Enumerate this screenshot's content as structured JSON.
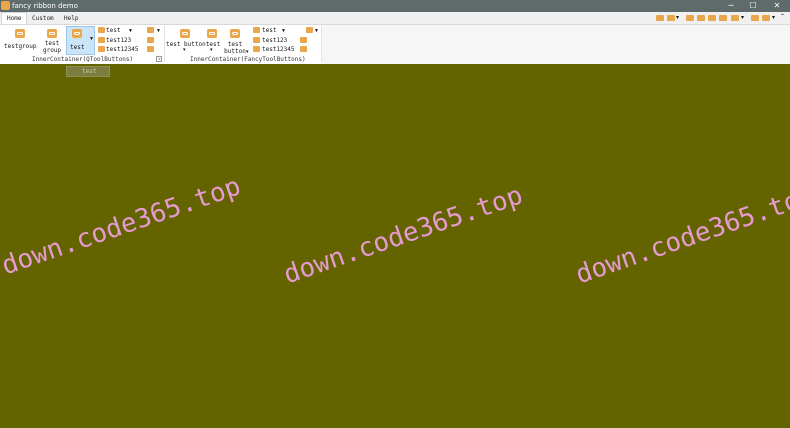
{
  "window": {
    "title": "fancy ribbon demo",
    "minimize": "─",
    "maximize": "☐",
    "close": "✕"
  },
  "tabs": [
    "Home",
    "Custom",
    "Help"
  ],
  "group1": {
    "testgroup": "testgroup",
    "test_group_line1": "test",
    "test_group_line2": "group",
    "test_dropdown": "test",
    "list": [
      "test",
      "test123",
      "test12345"
    ],
    "title": "InnerContainer(QToolButtons)"
  },
  "group2": {
    "test_button": "test button",
    "test": "test",
    "test_button2_line1": "test",
    "test_button2_line2": "button",
    "list": [
      "test",
      "test123",
      "test12345"
    ],
    "title": "InnerContainer(FancyToolButtons)"
  },
  "popup": {
    "item": "test"
  },
  "watermark": "down.code365.top",
  "colors": {
    "workspace": "#636300",
    "accent_icon": "#e9a64b",
    "watermark": "#e69ad0"
  }
}
